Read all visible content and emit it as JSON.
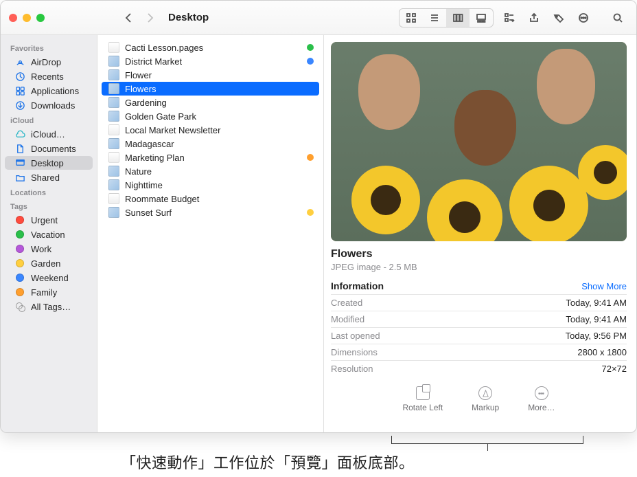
{
  "window_title": "Desktop",
  "sidebar": {
    "sections": [
      {
        "header": "Favorites",
        "items": [
          {
            "label": "AirDrop",
            "icon": "airdrop"
          },
          {
            "label": "Recents",
            "icon": "clock"
          },
          {
            "label": "Applications",
            "icon": "apps"
          },
          {
            "label": "Downloads",
            "icon": "download"
          }
        ]
      },
      {
        "header": "iCloud",
        "items": [
          {
            "label": "iCloud…",
            "icon": "cloud"
          },
          {
            "label": "Documents",
            "icon": "doc"
          },
          {
            "label": "Desktop",
            "icon": "desktop",
            "active": true
          },
          {
            "label": "Shared",
            "icon": "folder"
          }
        ]
      },
      {
        "header": "Locations",
        "items": []
      },
      {
        "header": "Tags",
        "items": [
          {
            "label": "Urgent",
            "tag": "#ff4b3e"
          },
          {
            "label": "Vacation",
            "tag": "#2abf4a"
          },
          {
            "label": "Work",
            "tag": "#b558d9"
          },
          {
            "label": "Garden",
            "tag": "#ffcf3f"
          },
          {
            "label": "Weekend",
            "tag": "#3a86ff"
          },
          {
            "label": "Family",
            "tag": "#ff9f2e"
          },
          {
            "label": "All Tags…",
            "tag": "all"
          }
        ]
      }
    ]
  },
  "files": [
    {
      "name": "Cacti Lesson.pages",
      "kind": "doc",
      "tag": "#2abf4a"
    },
    {
      "name": "District Market",
      "kind": "image",
      "tag": "#3a86ff"
    },
    {
      "name": "Flower",
      "kind": "image"
    },
    {
      "name": "Flowers",
      "kind": "image",
      "selected": true
    },
    {
      "name": "Gardening",
      "kind": "image"
    },
    {
      "name": "Golden Gate Park",
      "kind": "image"
    },
    {
      "name": "Local Market Newsletter",
      "kind": "doc"
    },
    {
      "name": "Madagascar",
      "kind": "image"
    },
    {
      "name": "Marketing Plan",
      "kind": "doc",
      "tag": "#ff9f2e"
    },
    {
      "name": "Nature",
      "kind": "image"
    },
    {
      "name": "Nighttime",
      "kind": "image"
    },
    {
      "name": "Roommate Budget",
      "kind": "doc"
    },
    {
      "name": "Sunset Surf",
      "kind": "image",
      "tag": "#ffcf3f"
    }
  ],
  "preview": {
    "title": "Flowers",
    "subtitle": "JPEG image - 2.5 MB",
    "info_header": "Information",
    "show_more": "Show More",
    "rows": [
      {
        "k": "Created",
        "v": "Today, 9:41 AM"
      },
      {
        "k": "Modified",
        "v": "Today, 9:41 AM"
      },
      {
        "k": "Last opened",
        "v": "Today, 9:56 PM"
      },
      {
        "k": "Dimensions",
        "v": "2800 x 1800"
      },
      {
        "k": "Resolution",
        "v": "72×72"
      }
    ],
    "actions": {
      "rotate": "Rotate Left",
      "markup": "Markup",
      "more": "More…"
    }
  },
  "caption": "「快速動作」工作位於「預覽」面板底部。"
}
